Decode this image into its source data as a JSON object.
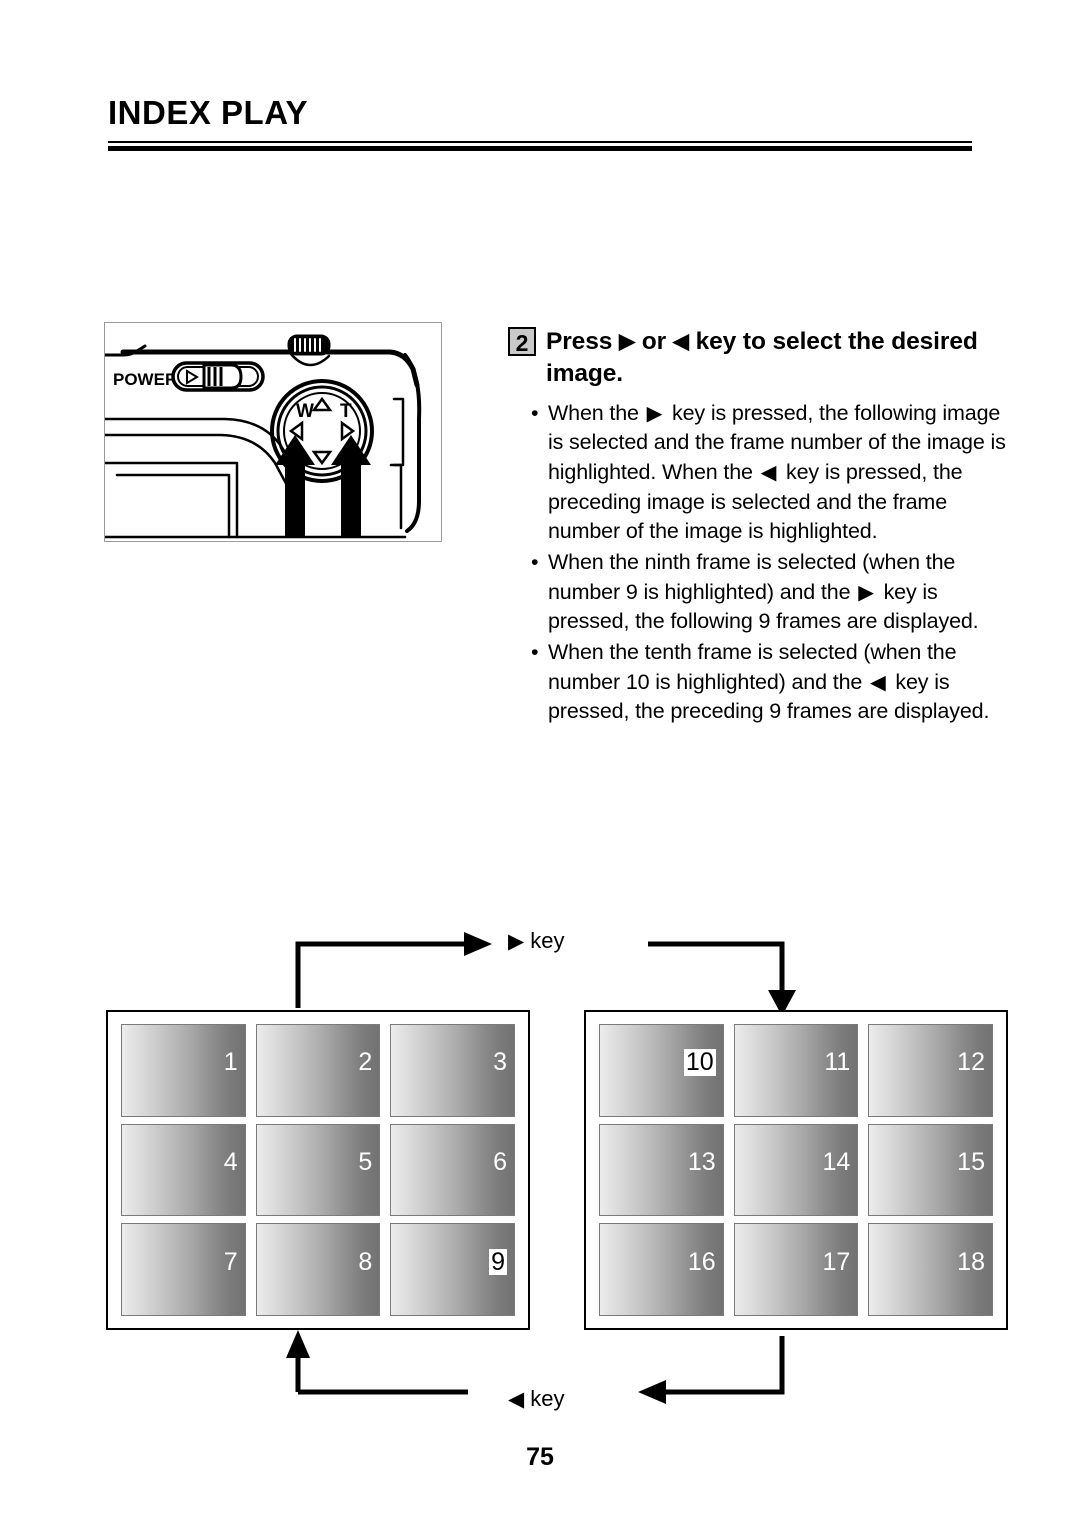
{
  "header": {
    "title": "INDEX PLAY"
  },
  "camera_figure": {
    "name": "camera-rear-illustration",
    "power_label": "POWER",
    "zoom_wide_label": "W",
    "zoom_tele_label": "T"
  },
  "instruction": {
    "step_number": "2",
    "heading": "Press ▶ or ◀ key to select the desired image.",
    "heading_parts": [
      {
        "type": "text",
        "value": "Press "
      },
      {
        "type": "icon",
        "value": "▶",
        "name": "right-arrow-icon"
      },
      {
        "type": "text",
        "value": " or "
      },
      {
        "type": "icon",
        "value": "◀",
        "name": "left-arrow-icon"
      },
      {
        "type": "text",
        "value": " key to select the desired image."
      }
    ],
    "bullets": [
      {
        "parts": [
          {
            "type": "text",
            "value": "When the "
          },
          {
            "type": "icon",
            "value": "▶"
          },
          {
            "type": "text",
            "value": " key is pressed, the following image is selected and the frame number of the image is highlighted. When the "
          },
          {
            "type": "icon",
            "value": "◀"
          },
          {
            "type": "text",
            "value": " key is pressed, the preceding image is selected and the frame number of the image is highlighted."
          }
        ]
      },
      {
        "parts": [
          {
            "type": "text",
            "value": "When the ninth frame is selected (when the number 9 is highlighted) and the "
          },
          {
            "type": "icon",
            "value": "▶"
          },
          {
            "type": "text",
            "value": " key is pressed, the following 9 frames are displayed."
          }
        ]
      },
      {
        "parts": [
          {
            "type": "text",
            "value": "When the tenth frame is selected (when the number 10 is highlighted) and the "
          },
          {
            "type": "icon",
            "value": "◀"
          },
          {
            "type": "text",
            "value": " key is pressed, the preceding 9 frames are displayed."
          }
        ]
      }
    ]
  },
  "flow": {
    "forward_key_icon": "▶",
    "forward_key_label": "key",
    "backward_key_icon": "◀",
    "backward_key_label": "key"
  },
  "index_grids": [
    {
      "name": "index-grid-left",
      "thumbnails": [
        {
          "number": "1",
          "highlighted": false
        },
        {
          "number": "2",
          "highlighted": false
        },
        {
          "number": "3",
          "highlighted": false
        },
        {
          "number": "4",
          "highlighted": false
        },
        {
          "number": "5",
          "highlighted": false
        },
        {
          "number": "6",
          "highlighted": false
        },
        {
          "number": "7",
          "highlighted": false
        },
        {
          "number": "8",
          "highlighted": false
        },
        {
          "number": "9",
          "highlighted": true
        }
      ]
    },
    {
      "name": "index-grid-right",
      "thumbnails": [
        {
          "number": "10",
          "highlighted": true
        },
        {
          "number": "11",
          "highlighted": false
        },
        {
          "number": "12",
          "highlighted": false
        },
        {
          "number": "13",
          "highlighted": false
        },
        {
          "number": "14",
          "highlighted": false
        },
        {
          "number": "15",
          "highlighted": false
        },
        {
          "number": "16",
          "highlighted": false
        },
        {
          "number": "17",
          "highlighted": false
        },
        {
          "number": "18",
          "highlighted": false
        }
      ]
    }
  ],
  "footer": {
    "page_number": "75"
  },
  "colors": {
    "ink": "#000000",
    "paper": "#ffffff",
    "step_badge_fill": "#c9c9c9",
    "thumb_light": "#ececec",
    "thumb_dark": "#727272",
    "highlight_bg": "#ffffff"
  }
}
